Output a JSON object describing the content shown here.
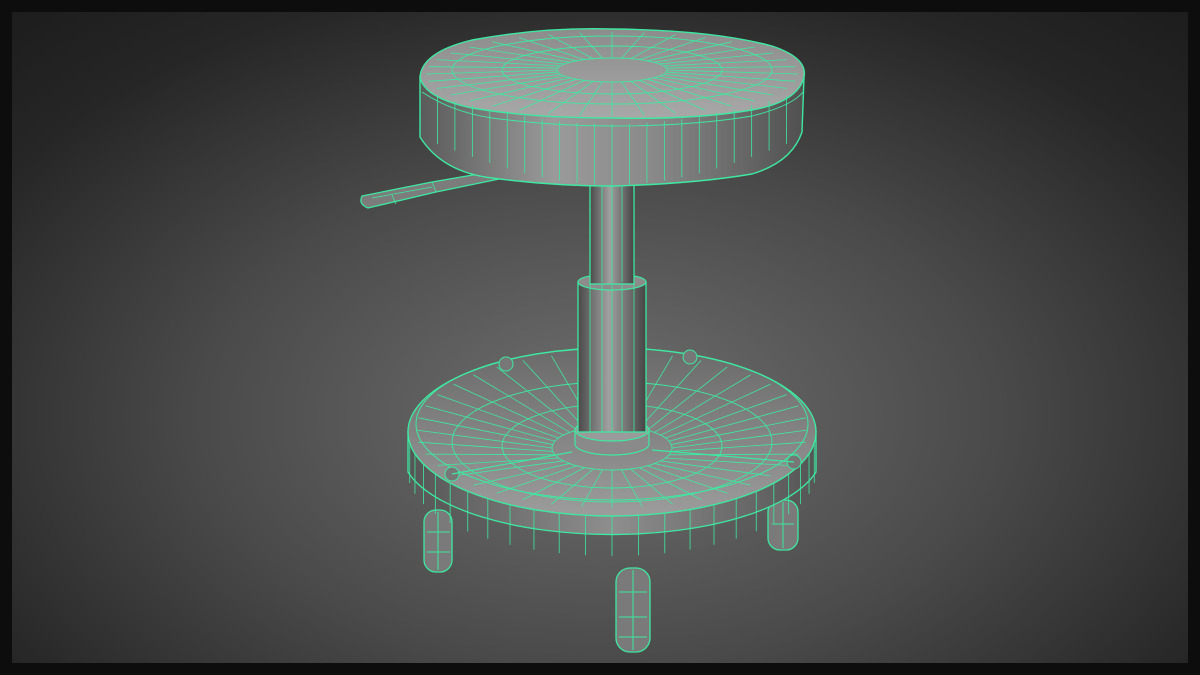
{
  "viewport": {
    "label": "",
    "background": "#1c1c1c",
    "frame_color": "#0d0d0d"
  },
  "wireframe": {
    "color": "#3fe8a0",
    "shade": "#8a8a8a",
    "shade_dark": "#4f4f4f"
  },
  "model": {
    "parts": [
      "seat-cushion",
      "height-lever",
      "gas-cylinder",
      "cylinder-sleeve",
      "base-tray",
      "caster-wheels"
    ]
  }
}
